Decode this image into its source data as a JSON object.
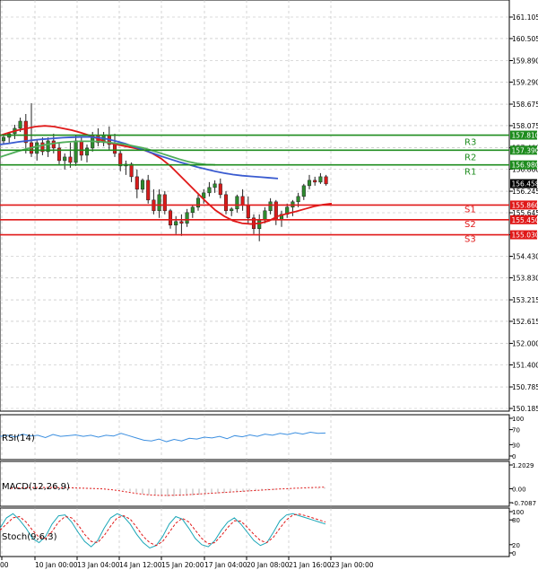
{
  "chart_data": [
    {
      "type": "candlestick",
      "panel": "price",
      "y_ticks": [
        "161.105",
        "160.505",
        "159.890",
        "159.290",
        "158.675",
        "158.075",
        "157.460",
        "156.860",
        "156.245",
        "155.645",
        "155.030",
        "154.430",
        "153.830",
        "153.215",
        "152.615",
        "152.000",
        "151.400",
        "150.785",
        "150.185"
      ],
      "ylim": [
        150.185,
        161.105
      ],
      "x_ticks": [
        "00",
        "10 Jan 00:00",
        "13 Jan 04:00",
        "14 Jan 12:00",
        "15 Jan 20:00",
        "17 Jan 04:00",
        "20 Jan 08:00",
        "21 Jan 16:00",
        "23 Jan 00:00"
      ],
      "levels": [
        {
          "name": "R3",
          "value": 157.81,
          "label": "157.810",
          "color": "#1e8c1e"
        },
        {
          "name": "R2",
          "value": 157.39,
          "label": "157.390",
          "color": "#1e8c1e"
        },
        {
          "name": "R1",
          "value": 156.98,
          "label": "156.980",
          "color": "#1e8c1e"
        },
        {
          "name": "S1",
          "value": 155.86,
          "label": "155.860",
          "color": "#e01818"
        },
        {
          "name": "S2",
          "value": 155.45,
          "label": "155.450",
          "color": "#e01818"
        },
        {
          "name": "S3",
          "value": 155.03,
          "label": "155.030",
          "color": "#e01818"
        }
      ],
      "current_price": {
        "value": 156.458,
        "label": "156.458"
      },
      "candles": [
        [
          157.65,
          157.8,
          157.55,
          157.75
        ],
        [
          157.75,
          157.9,
          157.6,
          157.85
        ],
        [
          157.85,
          158.1,
          157.7,
          158.0
        ],
        [
          158.0,
          158.3,
          157.9,
          158.2
        ],
        [
          158.2,
          158.4,
          157.3,
          157.6
        ],
        [
          157.6,
          158.7,
          157.2,
          157.3
        ],
        [
          157.3,
          157.7,
          157.1,
          157.6
        ],
        [
          157.6,
          157.75,
          157.25,
          157.35
        ],
        [
          157.35,
          157.75,
          157.2,
          157.65
        ],
        [
          157.65,
          157.85,
          157.3,
          157.45
        ],
        [
          157.45,
          157.6,
          157.0,
          157.1
        ],
        [
          157.1,
          157.3,
          156.85,
          157.2
        ],
        [
          157.2,
          157.6,
          156.9,
          157.05
        ],
        [
          157.05,
          157.8,
          156.95,
          157.65
        ],
        [
          157.65,
          157.75,
          157.1,
          157.25
        ],
        [
          157.25,
          157.55,
          157.05,
          157.45
        ],
        [
          157.45,
          157.9,
          157.35,
          157.8
        ],
        [
          157.8,
          158.0,
          157.5,
          157.6
        ],
        [
          157.6,
          157.9,
          157.5,
          157.8
        ],
        [
          157.8,
          158.05,
          157.4,
          157.55
        ],
        [
          157.55,
          157.85,
          157.2,
          157.3
        ],
        [
          157.3,
          157.4,
          156.8,
          156.95
        ],
        [
          156.95,
          157.1,
          156.7,
          157.0
        ],
        [
          157.0,
          157.05,
          156.5,
          156.65
        ],
        [
          156.65,
          156.85,
          156.05,
          156.3
        ],
        [
          156.3,
          156.6,
          156.2,
          156.55
        ],
        [
          156.55,
          156.7,
          155.9,
          156.0
        ],
        [
          156.0,
          156.3,
          155.6,
          155.7
        ],
        [
          155.7,
          156.3,
          155.5,
          156.15
        ],
        [
          156.15,
          156.25,
          155.6,
          155.7
        ],
        [
          155.7,
          155.75,
          155.2,
          155.3
        ],
        [
          155.3,
          155.55,
          155.05,
          155.4
        ],
        [
          155.4,
          155.6,
          155.0,
          155.35
        ],
        [
          155.35,
          155.75,
          155.25,
          155.65
        ],
        [
          155.65,
          155.85,
          155.5,
          155.8
        ],
        [
          155.8,
          156.2,
          155.7,
          156.05
        ],
        [
          156.05,
          156.3,
          155.9,
          156.2
        ],
        [
          156.2,
          156.5,
          156.1,
          156.35
        ],
        [
          156.35,
          156.55,
          156.2,
          156.45
        ],
        [
          156.45,
          156.6,
          156.05,
          156.15
        ],
        [
          156.15,
          156.25,
          155.6,
          155.7
        ],
        [
          155.7,
          155.8,
          155.55,
          155.75
        ],
        [
          155.75,
          156.15,
          155.65,
          156.1
        ],
        [
          156.1,
          156.3,
          155.7,
          155.85
        ],
        [
          155.85,
          156.1,
          155.35,
          155.5
        ],
        [
          155.5,
          155.6,
          155.05,
          155.2
        ],
        [
          155.2,
          155.6,
          154.85,
          155.45
        ],
        [
          155.45,
          155.8,
          155.35,
          155.7
        ],
        [
          155.7,
          156.05,
          155.6,
          155.95
        ],
        [
          155.95,
          156.0,
          155.3,
          155.45
        ],
        [
          155.45,
          155.7,
          155.25,
          155.6
        ],
        [
          155.6,
          155.9,
          155.5,
          155.8
        ],
        [
          155.8,
          156.0,
          155.55,
          155.95
        ],
        [
          155.95,
          156.2,
          155.8,
          156.1
        ],
        [
          156.1,
          156.45,
          156.0,
          156.4
        ],
        [
          156.4,
          156.7,
          156.3,
          156.55
        ],
        [
          156.55,
          156.65,
          156.4,
          156.5
        ],
        [
          156.5,
          156.75,
          156.45,
          156.65
        ],
        [
          156.65,
          156.7,
          156.4,
          156.45
        ]
      ],
      "overlays": [
        {
          "name": "fast",
          "color": "#e01818",
          "values": [
            157.8,
            157.88,
            157.95,
            158.0,
            158.05,
            158.07,
            158.05,
            158.0,
            157.95,
            157.88,
            157.8,
            157.7,
            157.6,
            157.55,
            157.5,
            157.45,
            157.4,
            157.3,
            157.15,
            156.95,
            156.7,
            156.45,
            156.2,
            155.95,
            155.72,
            155.55,
            155.42,
            155.35,
            155.33,
            155.35,
            155.42,
            155.55,
            155.62,
            155.68,
            155.75,
            155.82,
            155.87,
            155.9
          ]
        },
        {
          "name": "mid",
          "color": "#3a5bd0",
          "values": [
            157.55,
            157.58,
            157.62,
            157.65,
            157.68,
            157.7,
            157.72,
            157.74,
            157.75,
            157.76,
            157.76,
            157.74,
            157.7,
            157.64,
            157.57,
            157.48,
            157.4,
            157.31,
            157.22,
            157.14,
            157.06,
            156.99,
            156.92,
            156.86,
            156.8,
            156.75,
            156.71,
            156.68,
            156.66,
            156.64,
            156.62,
            156.6
          ]
        },
        {
          "name": "slow",
          "color": "#4fae5a",
          "values": [
            157.2,
            157.28,
            157.36,
            157.43,
            157.49,
            157.54,
            157.58,
            157.61,
            157.63,
            157.64,
            157.64,
            157.63,
            157.61,
            157.58,
            157.55,
            157.5,
            157.45,
            157.38,
            157.3,
            157.22,
            157.14,
            157.07,
            157.02,
            156.99,
            156.98
          ]
        }
      ]
    },
    {
      "type": "line",
      "panel": "rsi",
      "label": "RSI(14)",
      "y_ticks": [
        "100",
        "70",
        "30",
        "0"
      ],
      "ylim": [
        0,
        100
      ],
      "color": "#3c8fe0",
      "values": [
        52,
        55,
        50,
        58,
        53,
        55,
        49,
        57,
        52,
        54,
        56,
        52,
        55,
        50,
        55,
        53,
        60,
        54,
        48,
        42,
        40,
        45,
        38,
        44,
        40,
        47,
        45,
        50,
        48,
        52,
        46,
        54,
        51,
        56,
        52,
        58,
        55,
        60,
        57,
        62,
        58,
        63,
        60,
        61
      ]
    },
    {
      "type": "histogram",
      "panel": "macd",
      "label": "MACD(12,26,9)",
      "y_ticks": [
        "1.2029",
        "0.00",
        "-0.7087"
      ],
      "ylim": [
        -0.7087,
        1.2029
      ],
      "color": "#c0c0c0",
      "signal_color": "#e01818",
      "values": [
        0.03,
        0.04,
        0.05,
        0.06,
        0.06,
        0.07,
        0.07,
        0.07,
        0.06,
        0.06,
        0.05,
        0.05,
        0.04,
        0.03,
        0.02,
        0.01,
        0,
        -0.03,
        -0.08,
        -0.14,
        -0.2,
        -0.26,
        -0.31,
        -0.35,
        -0.38,
        -0.39,
        -0.39,
        -0.38,
        -0.36,
        -0.34,
        -0.31,
        -0.29,
        -0.26,
        -0.24,
        -0.22,
        -0.2,
        -0.18,
        -0.16,
        -0.14,
        -0.12,
        -0.1,
        -0.08,
        -0.06,
        -0.04,
        -0.03,
        -0.01,
        0.01,
        0.02,
        0.04,
        0.05,
        0.07
      ],
      "signal": [
        0.02,
        0.03,
        0.04,
        0.05,
        0.06,
        0.06,
        0.06,
        0.06,
        0.05,
        0.05,
        0.04,
        0.03,
        0.02,
        0.01,
        0,
        -0.02,
        -0.05,
        -0.09,
        -0.14,
        -0.19,
        -0.24,
        -0.28,
        -0.31,
        -0.33,
        -0.34,
        -0.34,
        -0.33,
        -0.32,
        -0.31,
        -0.29,
        -0.27,
        -0.25,
        -0.23,
        -0.21,
        -0.19,
        -0.17,
        -0.15,
        -0.13,
        -0.11,
        -0.09,
        -0.07,
        -0.05,
        -0.03,
        -0.01,
        0,
        0.02,
        0.03,
        0.05,
        0.06,
        0.07,
        0.08
      ]
    },
    {
      "type": "line",
      "panel": "stoch",
      "label": "Stoch(9,6,3)",
      "y_ticks": [
        "100",
        "80",
        "20",
        "0"
      ],
      "ylim": [
        0,
        100
      ],
      "series": [
        {
          "color": "#1aa6b7",
          "values": [
            60,
            85,
            95,
            80,
            60,
            35,
            25,
            40,
            70,
            90,
            92,
            75,
            50,
            28,
            15,
            30,
            60,
            85,
            95,
            88,
            70,
            45,
            25,
            12,
            18,
            40,
            70,
            88,
            82,
            60,
            35,
            20,
            15,
            30,
            55,
            75,
            85,
            70,
            50,
            30,
            18,
            25,
            50,
            78,
            92,
            95,
            90,
            85,
            80,
            75,
            70
          ]
        },
        {
          "color": "#e01818",
          "values": [
            55,
            70,
            85,
            88,
            75,
            55,
            38,
            35,
            52,
            75,
            88,
            85,
            68,
            45,
            28,
            25,
            42,
            65,
            85,
            90,
            82,
            62,
            40,
            25,
            18,
            28,
            50,
            72,
            84,
            75,
            55,
            35,
            22,
            25,
            42,
            62,
            78,
            77,
            62,
            45,
            30,
            25,
            38,
            60,
            80,
            92,
            94,
            90,
            85,
            80,
            75
          ]
        }
      ]
    }
  ]
}
